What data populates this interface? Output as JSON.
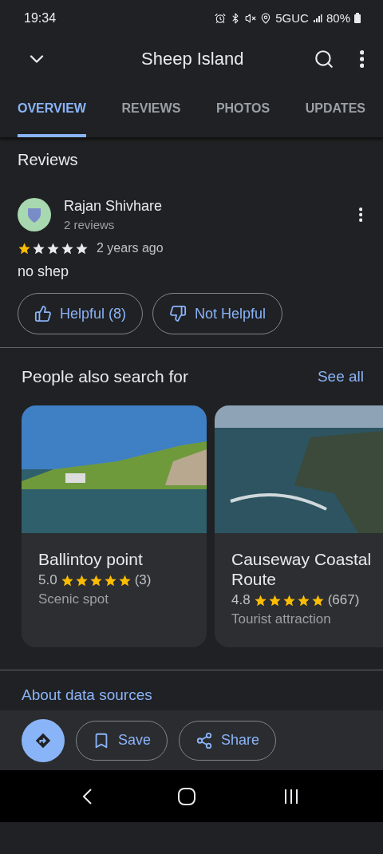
{
  "status_bar": {
    "time": "19:34",
    "network": "5GUC",
    "battery": "80%"
  },
  "header": {
    "title": "Sheep Island"
  },
  "tabs": [
    {
      "label": "OVERVIEW",
      "selected": true
    },
    {
      "label": "REVIEWS",
      "selected": false
    },
    {
      "label": "PHOTOS",
      "selected": false
    },
    {
      "label": "UPDATES",
      "selected": false
    }
  ],
  "reviews": {
    "heading": "Reviews",
    "items": [
      {
        "author": "Rajan Shivhare",
        "author_meta": "2 reviews",
        "stars": 1,
        "time": "2 years ago",
        "text": "no shep",
        "helpful": "Helpful (8)",
        "not_helpful": "Not Helpful"
      }
    ]
  },
  "people_also_search": {
    "heading": "People also search for",
    "see_all": "See all",
    "places": [
      {
        "name": "Ballintoy point",
        "rating": "5.0",
        "stars": 5,
        "count": "(3)",
        "category": "Scenic spot"
      },
      {
        "name": "Causeway Coastal Route",
        "rating": "4.8",
        "stars": 5,
        "count": "(667)",
        "category": "Tourist attraction"
      }
    ]
  },
  "about_link": "About data sources",
  "actions": [
    {
      "kind": "directions"
    },
    {
      "kind": "save",
      "label": "Save"
    },
    {
      "kind": "share",
      "label": "Share"
    }
  ]
}
